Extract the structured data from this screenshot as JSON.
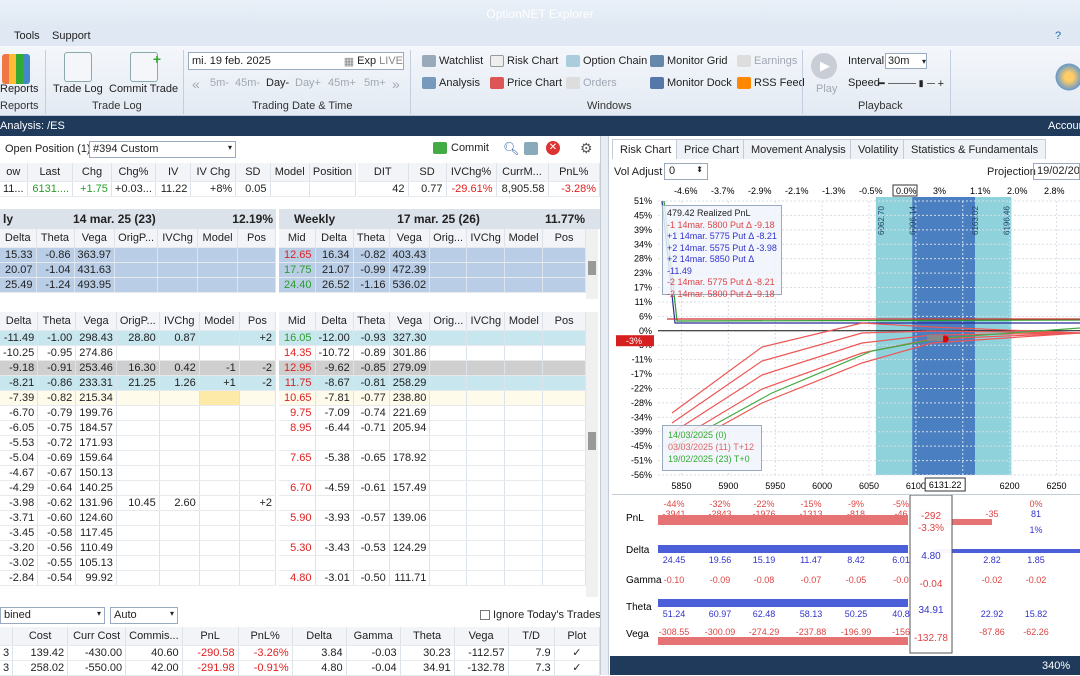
{
  "app": {
    "title": "OptionNET Explorer"
  },
  "menu": {
    "items": [
      "Tools",
      "Support"
    ]
  },
  "ribbon": {
    "reports": {
      "label": "Reports",
      "group": "Reports"
    },
    "trade_log": {
      "btn1": "Trade Log",
      "btn2": "Commit Trade",
      "group": "Trade Log"
    },
    "date": {
      "value": "mi. 19 feb. 2025",
      "exp": "Exp",
      "live": "LIVE",
      "steps": [
        "5m-",
        "45m-",
        "Day-",
        "Day+",
        "45m+",
        "5m+"
      ],
      "group": "Trading Date & Time"
    },
    "windows": {
      "items": [
        "Watchlist",
        "Risk Chart",
        "Option Chain",
        "Monitor Grid",
        "Earnings",
        "Analysis",
        "Price Chart",
        "Orders",
        "Monitor Dock",
        "RSS Feed"
      ],
      "group": "Windows"
    },
    "playback": {
      "play": "Play",
      "interval_label": "Interval",
      "interval_value": "30m",
      "speed_label": "Speed",
      "group": "Playback"
    }
  },
  "nav": {
    "left": "Analysis: /ES",
    "right": "Accoun"
  },
  "left": {
    "position_label": "Open Position (1)",
    "position_select": "#394 Custom",
    "commit": "Commit",
    "summary_headers": [
      "ow",
      "Last",
      "Chg",
      "Chg%",
      "IV",
      "IV Chg",
      "SD",
      "Model",
      "Position"
    ],
    "summary_values": [
      "11...",
      "6131....",
      "+1.75",
      "+0.03...",
      "11.22",
      "+8%",
      "0.05",
      "",
      ""
    ],
    "summary2_headers": [
      "DIT",
      "SD",
      "IVChg%",
      "CurrM...",
      "PnL%"
    ],
    "summary2_values": [
      "42",
      "0.77",
      "-29.61%",
      "8,905.58",
      "-3.28%"
    ],
    "chainA": {
      "title_left": "ly",
      "date": "14 mar. 25 (23)",
      "pct": "12.19%",
      "headers": [
        "Delta",
        "Theta",
        "Vega",
        "OrigP...",
        "IVChg",
        "Model",
        "Pos"
      ],
      "top_rows": [
        [
          "15.33",
          "-0.86",
          "363.97"
        ],
        [
          "20.07",
          "-1.04",
          "431.63"
        ],
        [
          "25.49",
          "-1.24",
          "493.95"
        ]
      ],
      "rows": [
        [
          "-11.49",
          "-1.00",
          "298.43",
          "28.80",
          "0.87",
          "",
          "+2"
        ],
        [
          "-10.25",
          "-0.95",
          "274.86",
          "",
          "",
          "",
          ""
        ],
        [
          "-9.18",
          "-0.91",
          "253.46",
          "16.30",
          "0.42",
          "-1",
          "-2"
        ],
        [
          "-8.21",
          "-0.86",
          "233.31",
          "21.25",
          "1.26",
          "+1",
          "-2"
        ],
        [
          "-7.39",
          "-0.82",
          "215.34",
          "",
          "",
          "",
          ""
        ],
        [
          "-6.70",
          "-0.79",
          "199.76",
          "",
          "",
          "",
          ""
        ],
        [
          "-6.05",
          "-0.75",
          "184.57",
          "",
          "",
          "",
          ""
        ],
        [
          "-5.53",
          "-0.72",
          "171.93",
          "",
          "",
          "",
          ""
        ],
        [
          "-5.04",
          "-0.69",
          "159.64",
          "",
          "",
          "",
          ""
        ],
        [
          "-4.67",
          "-0.67",
          "150.13",
          "",
          "",
          "",
          ""
        ],
        [
          "-4.29",
          "-0.64",
          "140.25",
          "",
          "",
          "",
          ""
        ],
        [
          "-3.98",
          "-0.62",
          "131.96",
          "10.45",
          "2.60",
          "",
          "+2"
        ],
        [
          "-3.71",
          "-0.60",
          "124.60",
          "",
          "",
          "",
          ""
        ],
        [
          "-3.45",
          "-0.58",
          "117.45",
          "",
          "",
          "",
          ""
        ],
        [
          "-3.20",
          "-0.56",
          "110.49",
          "",
          "",
          "",
          ""
        ],
        [
          "-3.02",
          "-0.55",
          "105.13",
          "",
          "",
          "",
          ""
        ],
        [
          "-2.84",
          "-0.54",
          "99.92",
          "",
          "",
          "",
          ""
        ]
      ]
    },
    "chainB": {
      "title_left": "Weekly",
      "date": "17 mar. 25 (26)",
      "pct": "11.77%",
      "headers": [
        "Mid",
        "Delta",
        "Theta",
        "Vega",
        "Orig...",
        "IVChg",
        "Model",
        "Pos"
      ],
      "top_rows": [
        [
          "12.65",
          "16.34",
          "-0.82",
          "403.43"
        ],
        [
          "17.75",
          "21.07",
          "-0.99",
          "472.39"
        ],
        [
          "24.40",
          "26.52",
          "-1.16",
          "536.02"
        ]
      ],
      "rows": [
        [
          "16.05",
          "-12.00",
          "-0.93",
          "327.30"
        ],
        [
          "14.35",
          "-10.72",
          "-0.89",
          "301.86"
        ],
        [
          "12.95",
          "-9.62",
          "-0.85",
          "279.09"
        ],
        [
          "11.75",
          "-8.67",
          "-0.81",
          "258.29"
        ],
        [
          "10.65",
          "-7.81",
          "-0.77",
          "238.80"
        ],
        [
          "9.75",
          "-7.09",
          "-0.74",
          "221.69"
        ],
        [
          "8.95",
          "-6.44",
          "-0.71",
          "205.94"
        ],
        [
          "",
          "",
          " ",
          ""
        ],
        [
          "7.65",
          "-5.38",
          "-0.65",
          "178.92"
        ],
        [
          "",
          "",
          "",
          ""
        ],
        [
          "6.70",
          "-4.59",
          "-0.61",
          "157.49"
        ],
        [
          "",
          "",
          "",
          ""
        ],
        [
          "5.90",
          "-3.93",
          "-0.57",
          "139.06"
        ],
        [
          "",
          "",
          "",
          ""
        ],
        [
          "5.30",
          "-3.43",
          "-0.53",
          "124.29"
        ],
        [
          "",
          "",
          "",
          ""
        ],
        [
          "4.80",
          "-3.01",
          "-0.50",
          "111.71"
        ]
      ]
    },
    "bottom": {
      "combo1": "bined",
      "combo2": "Auto",
      "ignore": "Ignore Today's Trades",
      "headers": [
        "Cost",
        "Curr Cost",
        "Commis...",
        "PnL",
        "PnL%",
        "Delta",
        "Gamma",
        "Theta",
        "Vega",
        "T/D",
        "Plot"
      ],
      "rows": [
        [
          "3",
          "139.42",
          "-430.00",
          "40.60",
          "-290.58",
          "-3.26%",
          "3.84",
          "-0.03",
          "30.23",
          "-112.57",
          "7.9",
          "✓"
        ],
        [
          "3",
          "258.02",
          "-550.00",
          "42.00",
          "-291.98",
          "-0.91%",
          "4.80",
          "-0.04",
          "34.91",
          "-132.78",
          "7.3",
          "✓"
        ]
      ]
    }
  },
  "right": {
    "tabs": [
      "Risk Chart",
      "Price Chart",
      "Movement Analysis",
      "Volatility",
      "Statistics & Fundamentals"
    ],
    "vol_label": "Vol Adjust",
    "vol_value": "0",
    "proj_label": "Projection",
    "proj_value": "19/02/202",
    "top_pcts": [
      "-4.6%",
      "-3.7%",
      "-2.9%",
      "-2.1%",
      "-1.3%",
      "-0.5%",
      "0.0%",
      "3%",
      "1.1%",
      "2.0%",
      "2.8%"
    ],
    "legend": {
      "title": "479.42 Realized PnL",
      "items": [
        "-1  14mar. 5800 Put Δ   -9.18",
        "+1  14mar. 5775 Put Δ   -8.21",
        "+2  14mar. 5575 Put Δ   -3.98",
        "+2  14mar. 5850 Put Δ  -11.49",
        "-2  14mar. 5775 Put Δ   -8.21",
        "-2  14mar. 5800 Put Δ   -9.18"
      ]
    },
    "date_legend": [
      "14/03/2025 (0)",
      "03/03/2025 (11) T+12",
      "19/02/2025 (23) T+0"
    ],
    "current_price": "6131.22",
    "pnl_row": [
      "-44%",
      "-32%",
      "-22%",
      "-15%",
      "-9%",
      "-5%",
      "",
      "0%"
    ],
    "pnl_vals": [
      "-3941",
      "-2843",
      "-1976",
      "-1313",
      "-818",
      "-46",
      "-292",
      "-35",
      "81"
    ],
    "center": {
      "pnl": "-292",
      "pnl_pct": "-3.3%",
      "delta": "4.80",
      "gamma": "-0.04",
      "theta": "34.91",
      "vega": "-132.78"
    },
    "greek_labels": [
      "PnL",
      "Delta",
      "Gamma",
      "Theta",
      "Vega"
    ],
    "zoom": "340%"
  },
  "chart_data": {
    "type": "line",
    "title": "",
    "xlabel": "",
    "ylabel": "",
    "x_ticks": [
      5850,
      5900,
      5950,
      6000,
      6050,
      6100,
      6150,
      6200,
      6250
    ],
    "y_ticks": [
      "51%",
      "45%",
      "39%",
      "34%",
      "28%",
      "23%",
      "17%",
      "11%",
      "6%",
      "0%",
      "-5%",
      "-11%",
      "-17%",
      "-22%",
      "-28%",
      "-34%",
      "-39%",
      "-45%",
      "-51%",
      "-56%"
    ],
    "current_pct": "-3%",
    "strike_labels": [
      "6062.70",
      "6096.14",
      "6163.02",
      "6196.46"
    ],
    "delta_row": [
      "24.45",
      "19.56",
      "15.19",
      "11.47",
      "8.42",
      "6.01",
      "2.82",
      "1.85"
    ],
    "gamma_row": [
      "-0.10",
      "-0.09",
      "-0.08",
      "-0.07",
      "-0.05",
      "-0.0",
      "-0.02",
      "-0.02"
    ],
    "theta_row": [
      "51.24",
      "60.97",
      "62.48",
      "58.13",
      "50.25",
      "40.8",
      "22.92",
      "15.82"
    ],
    "vega_row": [
      "-308.55",
      "-300.09",
      "-274.29",
      "-237.88",
      "-196.99",
      "-156",
      "-87.86",
      "-62.26"
    ]
  }
}
